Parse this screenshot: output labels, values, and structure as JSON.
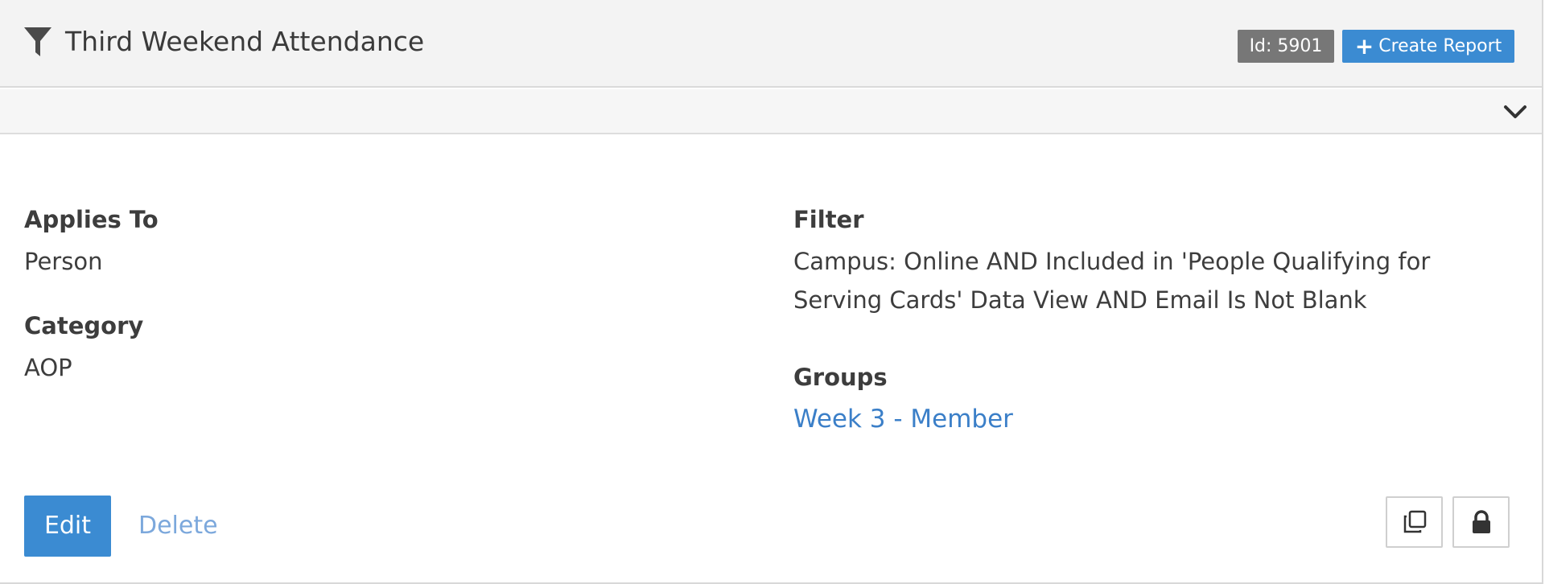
{
  "header": {
    "title": "Third Weekend Attendance",
    "icon": "filter-icon",
    "id_badge": "Id: 5901",
    "create_report_label": "Create Report"
  },
  "details": {
    "applies_to_label": "Applies To",
    "applies_to_value": "Person",
    "category_label": "Category",
    "category_value": "AOP",
    "filter_label": "Filter",
    "filter_line1": "Campus: Online AND Included in 'People Qualifying for",
    "filter_line2": "Serving Cards' Data View AND Email Is Not Blank",
    "groups_label": "Groups",
    "groups_value": "Week 3 - Member"
  },
  "actions": {
    "edit_label": "Edit",
    "delete_label": "Delete",
    "copy_icon": "copy-icon",
    "lock_icon": "lock-icon"
  },
  "colors": {
    "primary": "#3b8bd2",
    "badge": "#777777",
    "link": "#3b7fc8",
    "delete_link": "#7ca8dc",
    "header_bg": "#f3f3f3"
  }
}
